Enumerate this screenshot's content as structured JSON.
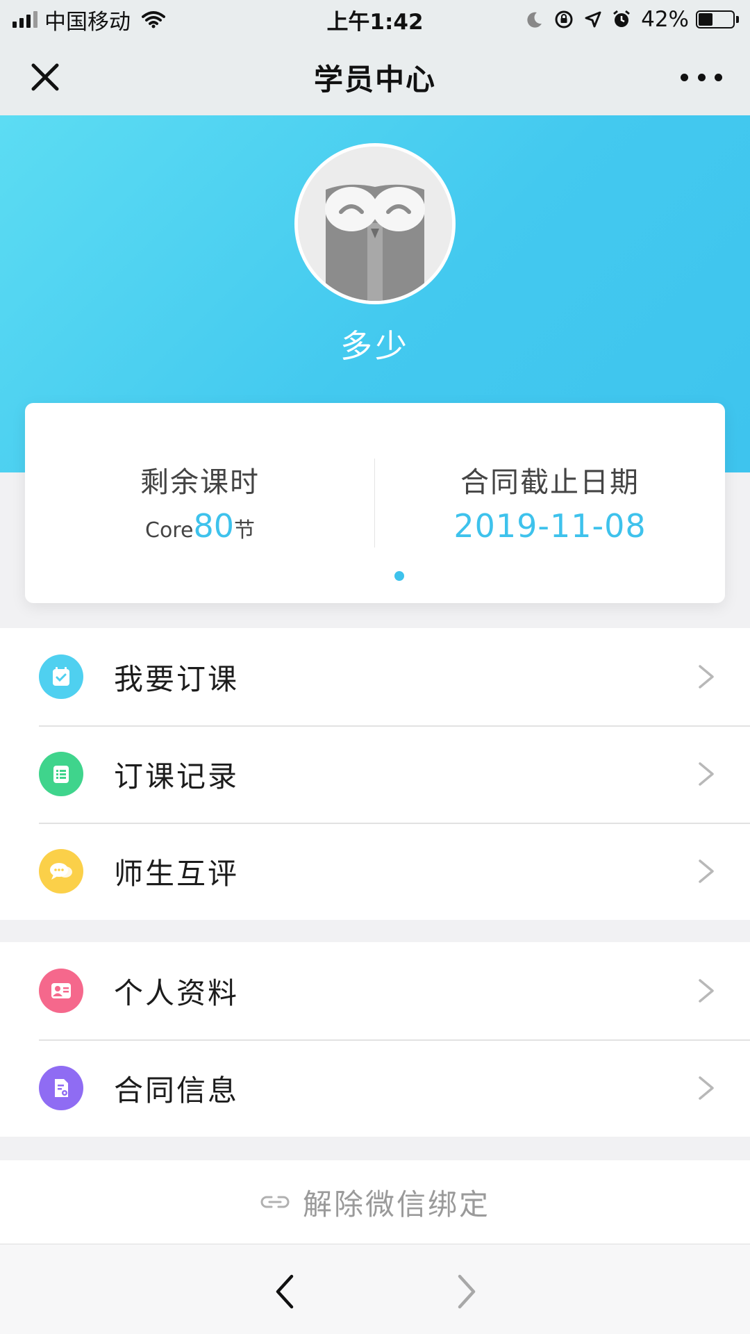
{
  "status_bar": {
    "carrier": "中国移动",
    "time": "上午1:42",
    "battery_percent": "42%",
    "battery_level": 0.42,
    "icons": [
      "signal-icon",
      "wifi-icon",
      "moon-icon",
      "rotation-lock-icon",
      "location-icon",
      "alarm-icon",
      "battery-icon"
    ]
  },
  "nav": {
    "title": "学员中心",
    "close_icon": "close-icon",
    "more_icon": "more-icon"
  },
  "profile": {
    "name": "多少",
    "avatar_icon": "owl-avatar"
  },
  "stats": {
    "remaining_label": "剩余课时",
    "remaining_prefix": "Core",
    "remaining_value": "80",
    "remaining_unit": "节",
    "contract_label": "合同截止日期",
    "contract_date": "2019-11-08"
  },
  "menu": {
    "group1": [
      {
        "label": "我要订课",
        "icon": "booking-icon",
        "color": "#4fd0f0"
      },
      {
        "label": "订课记录",
        "icon": "record-list-icon",
        "color": "#3fd48c"
      },
      {
        "label": "师生互评",
        "icon": "chat-bubble-icon",
        "color": "#fbd049"
      }
    ],
    "group2": [
      {
        "label": "个人资料",
        "icon": "profile-card-icon",
        "color": "#f5688c"
      },
      {
        "label": "合同信息",
        "icon": "contract-doc-icon",
        "color": "#8f6cf3"
      }
    ]
  },
  "unbind": {
    "label": "解除微信绑定",
    "icon": "link-icon"
  },
  "toolbar": {
    "back_icon": "back-arrow-icon",
    "forward_icon": "forward-arrow-icon"
  },
  "colors": {
    "accent": "#3ec2ec",
    "hero_start": "#5cdcf3",
    "hero_end": "#3ec4ee"
  }
}
